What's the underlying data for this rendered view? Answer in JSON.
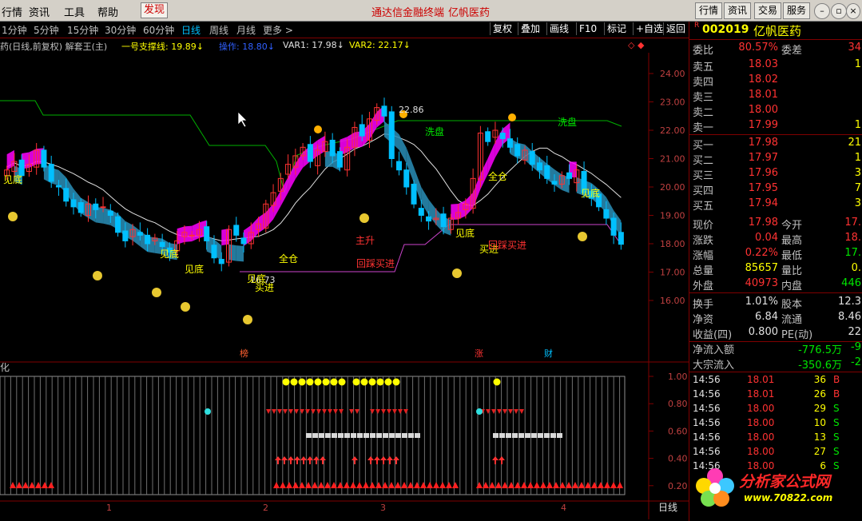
{
  "menu": {
    "items": [
      "行情",
      "资讯",
      "工具",
      "帮助"
    ],
    "hot_item": "发现",
    "title_left": "通达信金融终端",
    "title_right": "亿帆医药",
    "right_buttons": [
      "行情",
      "资讯",
      "交易",
      "服务"
    ]
  },
  "periods": [
    "1分钟",
    "5分钟",
    "15分钟",
    "30分钟",
    "60分钟",
    "日线",
    "周线",
    "月线",
    "更多 >"
  ],
  "active_period": "日线",
  "toolbar": [
    "复权",
    "叠加",
    "画线",
    "F10",
    "标记",
    "+自选",
    "返回"
  ],
  "indicators": {
    "name": "药(日线,前复权) 解套王(主)",
    "support": "一号支撑线: 19.89↓",
    "operate": "操作: 18.80↓",
    "var1": "VAR1: 17.98↓",
    "var2": "VAR2: 22.17↓"
  },
  "price_axis": [
    "24.00",
    "23.00",
    "22.00",
    "21.00",
    "20.00",
    "19.00",
    "18.00",
    "17.00",
    "16.00"
  ],
  "sub_axis": [
    "1.00",
    "0.80",
    "0.60",
    "0.40",
    "0.20"
  ],
  "chart_labels": {
    "high_price": "22.86",
    "low_price": "16.73",
    "washout1": "洗盘",
    "washout2": "洗盘",
    "bottom1": "见底",
    "bottom2": "见底",
    "bottom3": "见底",
    "bottom4": "见底",
    "bottom5": "见底",
    "bottom6": "见底",
    "fullpos1": "全仓",
    "fullpos2": "全仓",
    "buy1": "买进",
    "buy2": "买进",
    "rise": "主升",
    "pullback1": "回踩买进",
    "pullback2": "回踩买进",
    "mark_bang": "榜",
    "mark_zhang": "涨",
    "mark_cai": "财",
    "sub_title": "化"
  },
  "date_axis": [
    "1",
    "2",
    "3",
    "4"
  ],
  "date_axis_right": "日线",
  "stock": {
    "badge": "R",
    "code": "002019",
    "name": "亿帆医药",
    "weibi_label": "委比",
    "weibi": "80.57%",
    "weicha_label": "委差",
    "weicha": "34"
  },
  "order_book": [
    {
      "label": "卖五",
      "price": "18.03",
      "vol": "1"
    },
    {
      "label": "卖四",
      "price": "18.02",
      "vol": ""
    },
    {
      "label": "卖三",
      "price": "18.01",
      "vol": ""
    },
    {
      "label": "卖二",
      "price": "18.00",
      "vol": ""
    },
    {
      "label": "卖一",
      "price": "17.99",
      "vol": "1"
    },
    {
      "label": "买一",
      "price": "17.98",
      "vol": "21"
    },
    {
      "label": "买二",
      "price": "17.97",
      "vol": "1"
    },
    {
      "label": "买三",
      "price": "17.96",
      "vol": "3"
    },
    {
      "label": "买四",
      "price": "17.95",
      "vol": "7"
    },
    {
      "label": "买五",
      "price": "17.94",
      "vol": "3"
    }
  ],
  "quote": [
    {
      "l1": "现价",
      "v1": "17.98",
      "c1": "red",
      "l2": "今开",
      "v2": "17.",
      "c2": "red"
    },
    {
      "l1": "涨跌",
      "v1": "0.04",
      "c1": "red",
      "l2": "最高",
      "v2": "18.",
      "c2": "red"
    },
    {
      "l1": "涨幅",
      "v1": "0.22%",
      "c1": "red",
      "l2": "最低",
      "v2": "17.",
      "c2": "green"
    },
    {
      "l1": "总量",
      "v1": "85657",
      "c1": "yellow",
      "l2": "量比",
      "v2": "0.",
      "c2": "yellow"
    },
    {
      "l1": "外盘",
      "v1": "40973",
      "c1": "red",
      "l2": "内盘",
      "v2": "446",
      "c2": "green"
    },
    {
      "l1": "换手",
      "v1": "1.01%",
      "c1": "white",
      "l2": "股本",
      "v2": "12.3",
      "c2": "white"
    },
    {
      "l1": "净资",
      "v1": "6.84",
      "c1": "white",
      "l2": "流通",
      "v2": "8.46",
      "c2": "white"
    },
    {
      "l1": "收益(四)",
      "v1": "0.800",
      "c1": "white",
      "l2": "PE(动)",
      "v2": "22",
      "c2": "white"
    }
  ],
  "flow": [
    {
      "label": "净流入额",
      "value": "-776.5万",
      "tail": "-9"
    },
    {
      "label": "大宗流入",
      "value": "-350.6万",
      "tail": "-2"
    }
  ],
  "ticks": [
    {
      "time": "14:56",
      "price": "18.01",
      "vol": "36",
      "bs": "B"
    },
    {
      "time": "14:56",
      "price": "18.01",
      "vol": "26",
      "bs": "B"
    },
    {
      "time": "14:56",
      "price": "18.00",
      "vol": "29",
      "bs": "S"
    },
    {
      "time": "14:56",
      "price": "18.00",
      "vol": "10",
      "bs": "S"
    },
    {
      "time": "14:56",
      "price": "18.00",
      "vol": "13",
      "bs": "S"
    },
    {
      "time": "14:56",
      "price": "18.00",
      "vol": "27",
      "bs": "S"
    },
    {
      "time": "14:56",
      "price": "18.00",
      "vol": "6",
      "bs": "S"
    }
  ],
  "watermark": {
    "name": "分析家公式网",
    "url": "www.70822.com"
  },
  "colors": {
    "up": "#ff3232",
    "down": "#00c0ff",
    "magenta": "#ff00ff",
    "band": "#2a8fb8",
    "green_line": "#00b000"
  }
}
